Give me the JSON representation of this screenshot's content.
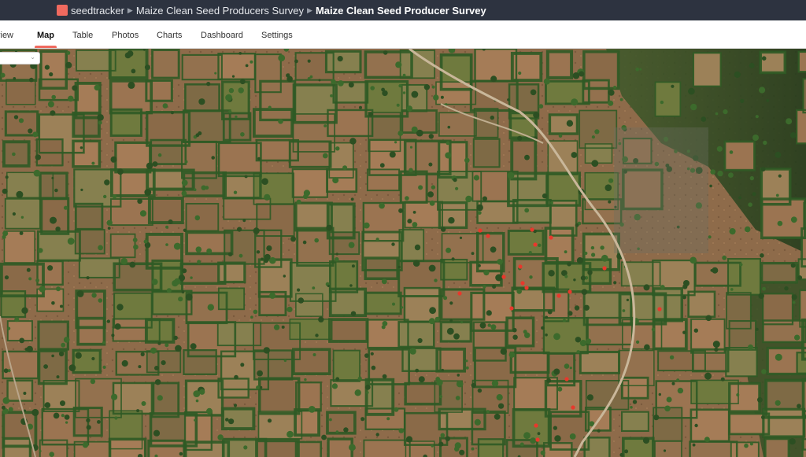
{
  "header": {
    "breadcrumbs": [
      {
        "label": "seedtracker"
      },
      {
        "label": "Maize Clean Seed Producers Survey"
      },
      {
        "label": "Maize Clean Seed Producer Survey"
      }
    ],
    "separator": "▶",
    "brand_color": "#f06a5f"
  },
  "tabs": [
    {
      "label": "view"
    },
    {
      "label": "Map",
      "active": true
    },
    {
      "label": "Table"
    },
    {
      "label": "Photos"
    },
    {
      "label": "Charts"
    },
    {
      "label": "Dashboard"
    },
    {
      "label": "Settings"
    }
  ],
  "map": {
    "layer_select": {
      "value": "",
      "icon": "chevron-down-icon"
    },
    "marker_color": "#e8382c",
    "marker_count": 19
  }
}
